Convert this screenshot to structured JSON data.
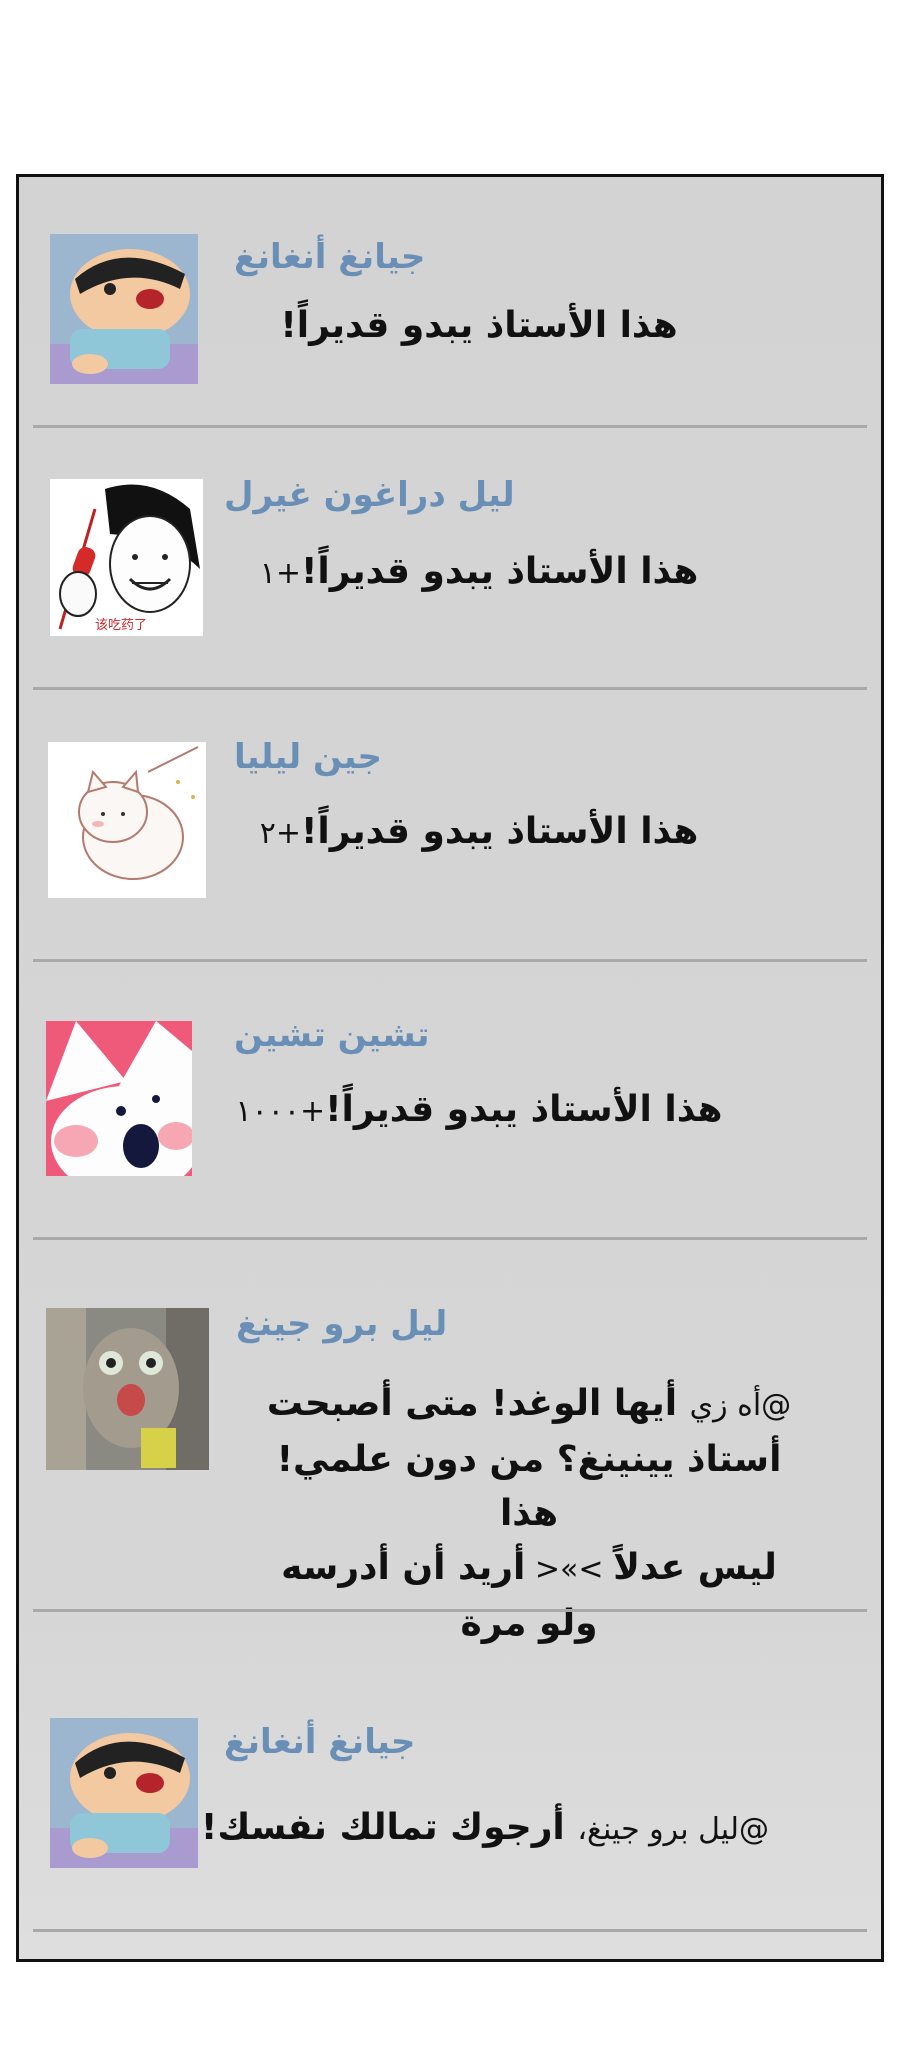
{
  "comments": [
    {
      "username": "جيانغ أنغانغ",
      "avatar": "crayon-shin-chan-avatar",
      "text": "هذا الأستاذ يبدو قديراً!",
      "suffix": ""
    },
    {
      "username": "ليل دراغون غيرل",
      "avatar": "meme-face-avatar",
      "text": "هذا الأستاذ يبدو قديراً!",
      "suffix": "+١"
    },
    {
      "username": "جين ليليا",
      "avatar": "white-cat-avatar",
      "text": "هذا الأستاذ يبدو قديراً!",
      "suffix": "+٢"
    },
    {
      "username": "تشين تشين",
      "avatar": "pink-bunny-avatar",
      "text": "هذا الأستاذ يبدو قديراً!",
      "suffix": "+١٠٠٠"
    },
    {
      "username": "ليل برو جينغ",
      "avatar": "shocked-cat-avatar",
      "mention": "@أه زي",
      "line1": "أيها الوغد! متى أصبحت",
      "line2": "أستاذ يينينغ؟ من دون علمي! هذا",
      "line3_a": "ليس عدلاً",
      "line3_mid": " >»< ",
      "line3_b": "أريد أن أدرسه ولو مرة"
    },
    {
      "username": "جيانغ أنغانغ",
      "avatar": "crayon-shin-chan-avatar",
      "mention": "@ليل برو جينغ،",
      "text": "أرجوك تمالك نفسك!"
    }
  ],
  "colors": {
    "username": "#6a8fb6",
    "panel_bg": "#d3d3d3",
    "divider": "#a9a9a9"
  }
}
